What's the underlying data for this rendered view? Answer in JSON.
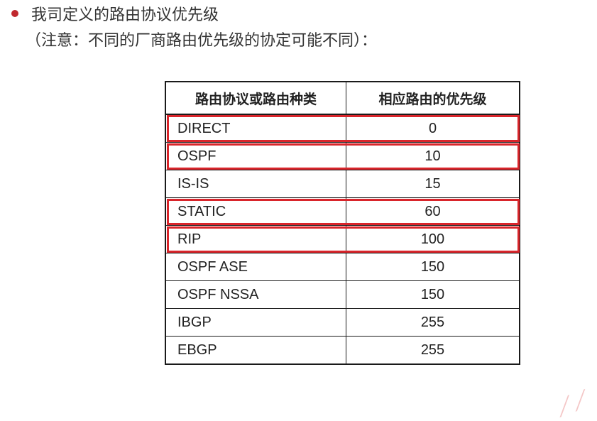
{
  "heading": {
    "bullet_text": "我司定义的路由协议优先级",
    "note_text": "（注意：不同的厂商路由优先级的协定可能不同）："
  },
  "table": {
    "headers": [
      "路由协议或路由种类",
      "相应路由的优先级"
    ],
    "rows": [
      {
        "name": "DIRECT",
        "value": "0",
        "highlighted": true
      },
      {
        "name": "OSPF",
        "value": "10",
        "highlighted": true
      },
      {
        "name": "IS-IS",
        "value": "15",
        "highlighted": false
      },
      {
        "name": "STATIC",
        "value": "60",
        "highlighted": true
      },
      {
        "name": "RIP",
        "value": "100",
        "highlighted": true
      },
      {
        "name": "OSPF ASE",
        "value": "150",
        "highlighted": false
      },
      {
        "name": "OSPF NSSA",
        "value": "150",
        "highlighted": false
      },
      {
        "name": "IBGP",
        "value": "255",
        "highlighted": false
      },
      {
        "name": "EBGP",
        "value": "255",
        "highlighted": false
      }
    ]
  },
  "colors": {
    "bullet": "#c0282e",
    "highlight": "#d9252b"
  }
}
